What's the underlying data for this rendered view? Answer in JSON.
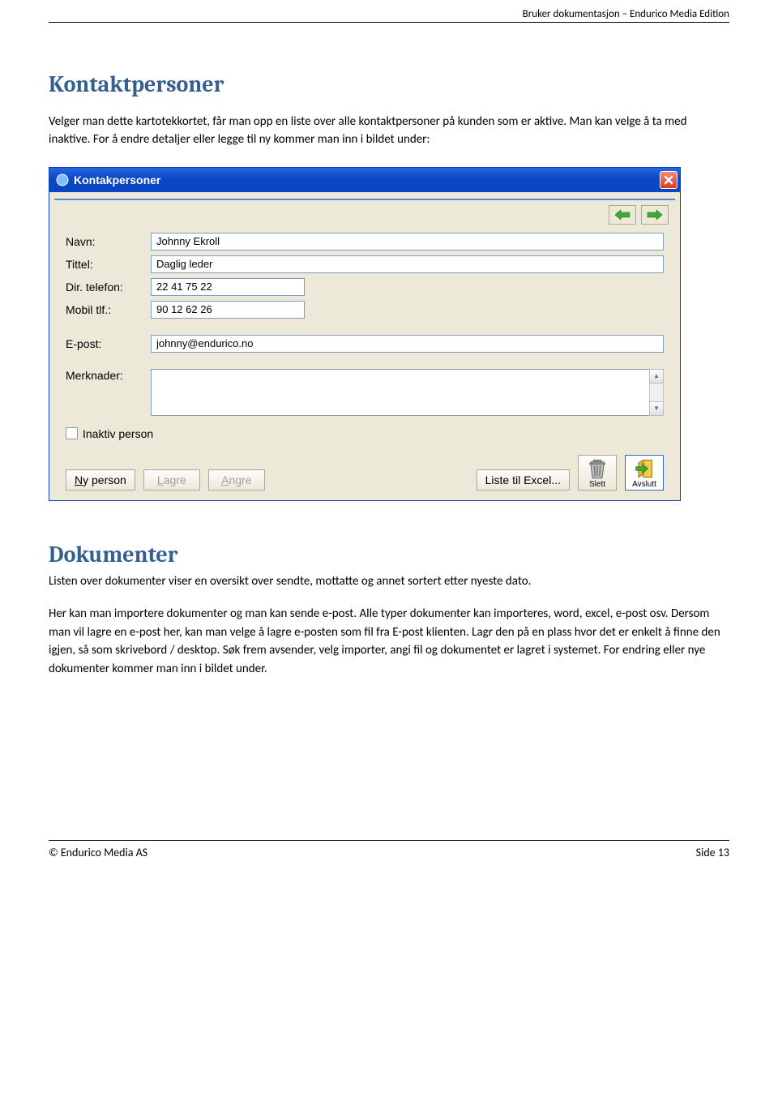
{
  "header_text": "Bruker dokumentasjon – Endurico Media Edition",
  "section1": {
    "title": "Kontaktpersoner",
    "intro": "Velger man dette kartotekkortet, får man opp en liste over alle kontaktpersoner på kunden som er aktive. Man kan velge å ta med inaktive. For å endre detaljer eller legge til ny kommer man inn i bildet under:"
  },
  "dialog": {
    "title": "Kontakpersoner",
    "labels": {
      "navn": "Navn:",
      "tittel": "Tittel:",
      "dir_telefon": "Dir. telefon:",
      "mobil": "Mobil tlf.:",
      "epost": "E-post:",
      "merknader": "Merknader:"
    },
    "values": {
      "navn": "Johnny Ekroll",
      "tittel": "Daglig leder",
      "dir_telefon": "22 41 75 22",
      "mobil": "90 12 62 26",
      "epost": "johnny@endurico.no",
      "merknader": ""
    },
    "checkbox_label": "Inaktiv person",
    "buttons": {
      "ny": "Ny person",
      "lagre": "Lagre",
      "angre": "Angre",
      "excel": "Liste til Excel...",
      "slett": "Slett",
      "avslutt": "Avslutt"
    }
  },
  "section2": {
    "title": "Dokumenter",
    "p1": "Listen over dokumenter viser en oversikt over sendte, mottatte og annet sortert etter nyeste dato.",
    "p2": "Her kan man importere dokumenter og man kan sende e-post. Alle typer dokumenter kan importeres, word, excel, e-post osv. Dersom man vil lagre en e-post her, kan man velge å lagre e-posten som fil fra E-post klienten. Lagr den på en plass hvor det er enkelt å finne den igjen, så som skrivebord / desktop. Søk frem avsender, velg importer, angi fil og dokumentet er lagret i systemet. For endring eller nye dokumenter kommer man inn i bildet under."
  },
  "footer": {
    "left": "© Endurico Media AS",
    "right": "Side 13"
  }
}
